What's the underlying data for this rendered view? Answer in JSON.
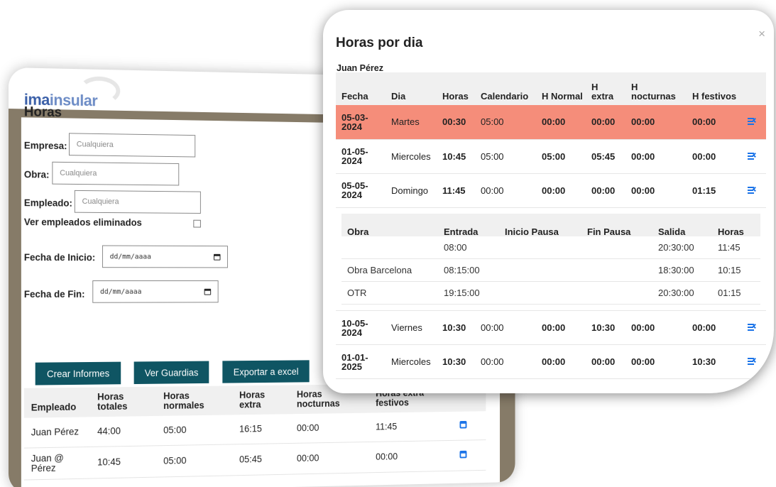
{
  "app": {
    "logo_bold": "ima",
    "logo_light": "insular"
  },
  "form": {
    "title": "Horas",
    "empresa_label": "Empresa:",
    "obra_label": "Obra:",
    "empleado_label": "Empleado:",
    "placeholder": "Cualquiera",
    "ver_eliminados_label": "Ver empleados eliminados",
    "fecha_inicio_label": "Fecha de Inicio:",
    "fecha_fin_label": "Fecha de Fin:",
    "date_placeholder": "dd/mm/aaaa"
  },
  "buttons": {
    "crear": "Crear Informes",
    "guardias": "Ver Guardias",
    "exportar": "Exportar a excel"
  },
  "summary": {
    "headers": [
      "Empleado",
      "Horas totales",
      "Horas normales",
      "Horas extra",
      "Horas nocturnas",
      "Horas extra festivos"
    ],
    "rows": [
      [
        "Juan Pérez",
        "44:00",
        "05:00",
        "16:15",
        "00:00",
        "11:45"
      ],
      [
        "Juan @ Pérez",
        "10:45",
        "05:00",
        "05:45",
        "00:00",
        "00:00"
      ]
    ]
  },
  "modal": {
    "title": "Horas por dia",
    "close": "×",
    "employee": "Juan Pérez",
    "headers": [
      "Fecha",
      "Dia",
      "Horas",
      "Calendario",
      "H Normal",
      "H extra",
      "H nocturnas",
      "H festivos"
    ],
    "rows": [
      [
        "05-03-2024",
        "Martes",
        "00:30",
        "05:00",
        "00:00",
        "00:00",
        "00:00",
        "00:00"
      ],
      [
        "01-05-2024",
        "Miercoles",
        "10:45",
        "05:00",
        "05:00",
        "05:45",
        "00:00",
        "00:00"
      ],
      [
        "05-05-2024",
        "Domingo",
        "11:45",
        "00:00",
        "00:00",
        "00:00",
        "00:00",
        "01:15"
      ],
      [
        "10-05-2024",
        "Viernes",
        "10:30",
        "00:00",
        "00:00",
        "10:30",
        "00:00",
        "00:00"
      ],
      [
        "01-01-2025",
        "Miercoles",
        "10:30",
        "00:00",
        "00:00",
        "00:00",
        "00:00",
        "10:30"
      ]
    ],
    "detail_headers": [
      "Obra",
      "Entrada",
      "Inicio Pausa",
      "Fin Pausa",
      "Salida",
      "Horas"
    ],
    "detail_rows": [
      [
        "",
        "08:00",
        "",
        "",
        "20:30:00",
        "11:45"
      ],
      [
        "Obra Barcelona",
        "08:15:00",
        "",
        "",
        "18:30:00",
        "10:15"
      ],
      [
        "OTR",
        "19:15:00",
        "",
        "",
        "20:30:00",
        "01:15"
      ]
    ]
  }
}
